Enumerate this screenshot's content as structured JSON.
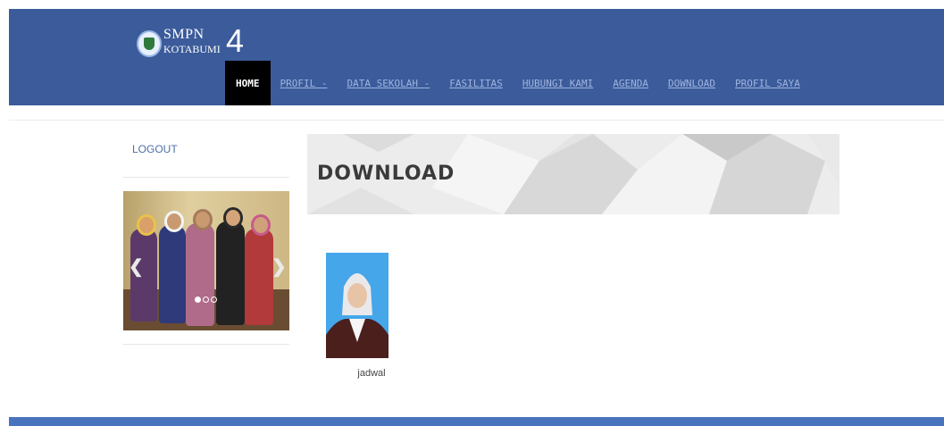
{
  "brand": {
    "line1": "SMPN",
    "line2": "KOTABUMI",
    "number": "4"
  },
  "nav": {
    "items": [
      {
        "label": "HOME",
        "active": true
      },
      {
        "label": "PROFIL -"
      },
      {
        "label": "DATA SEKOLAH -"
      },
      {
        "label": "FASILITAS"
      },
      {
        "label": "HUBUNGI KAMI"
      },
      {
        "label": "AGENDA"
      },
      {
        "label": "DOWNLOAD"
      },
      {
        "label": "PROFIL SAYA"
      }
    ]
  },
  "sidebar": {
    "logout_label": "LOGOUT",
    "slider": {
      "prev_icon": "chevron-left-icon",
      "next_icon": "chevron-right-icon",
      "slide_count": 3,
      "active_index": 0
    }
  },
  "main": {
    "banner_title": "DOWNLOAD",
    "downloads": [
      {
        "caption": "jadwal"
      }
    ]
  },
  "colors": {
    "header": "#3b5b9a",
    "nav_active": "#000000",
    "footer": "#4774bc",
    "link": "#4e6fa8"
  }
}
